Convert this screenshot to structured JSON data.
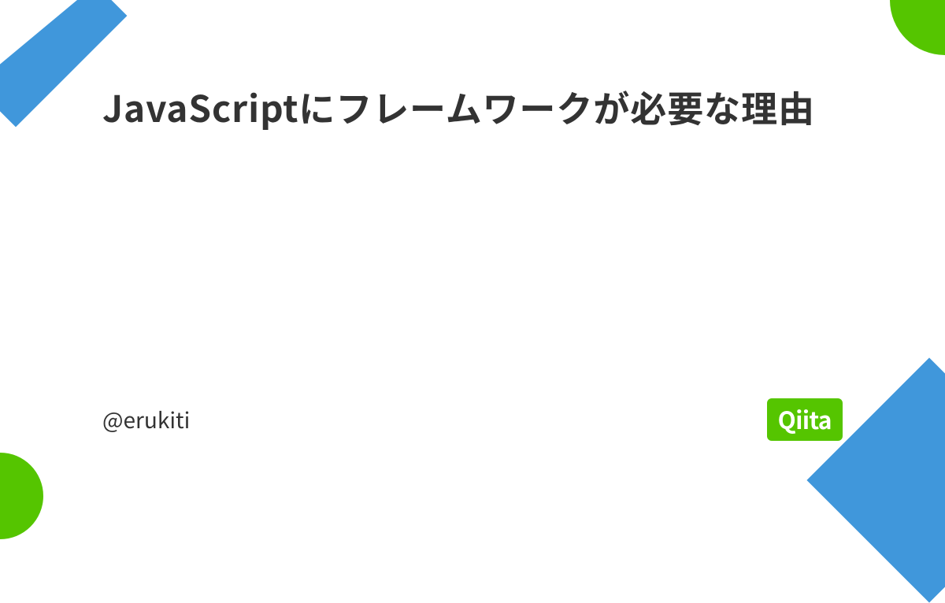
{
  "title": "JavaScriptにフレームワークが必要な理由",
  "author": "@erukiti",
  "brand": "Qiita",
  "colors": {
    "green": "#55c500",
    "blue": "#4097db",
    "text": "#333333"
  }
}
